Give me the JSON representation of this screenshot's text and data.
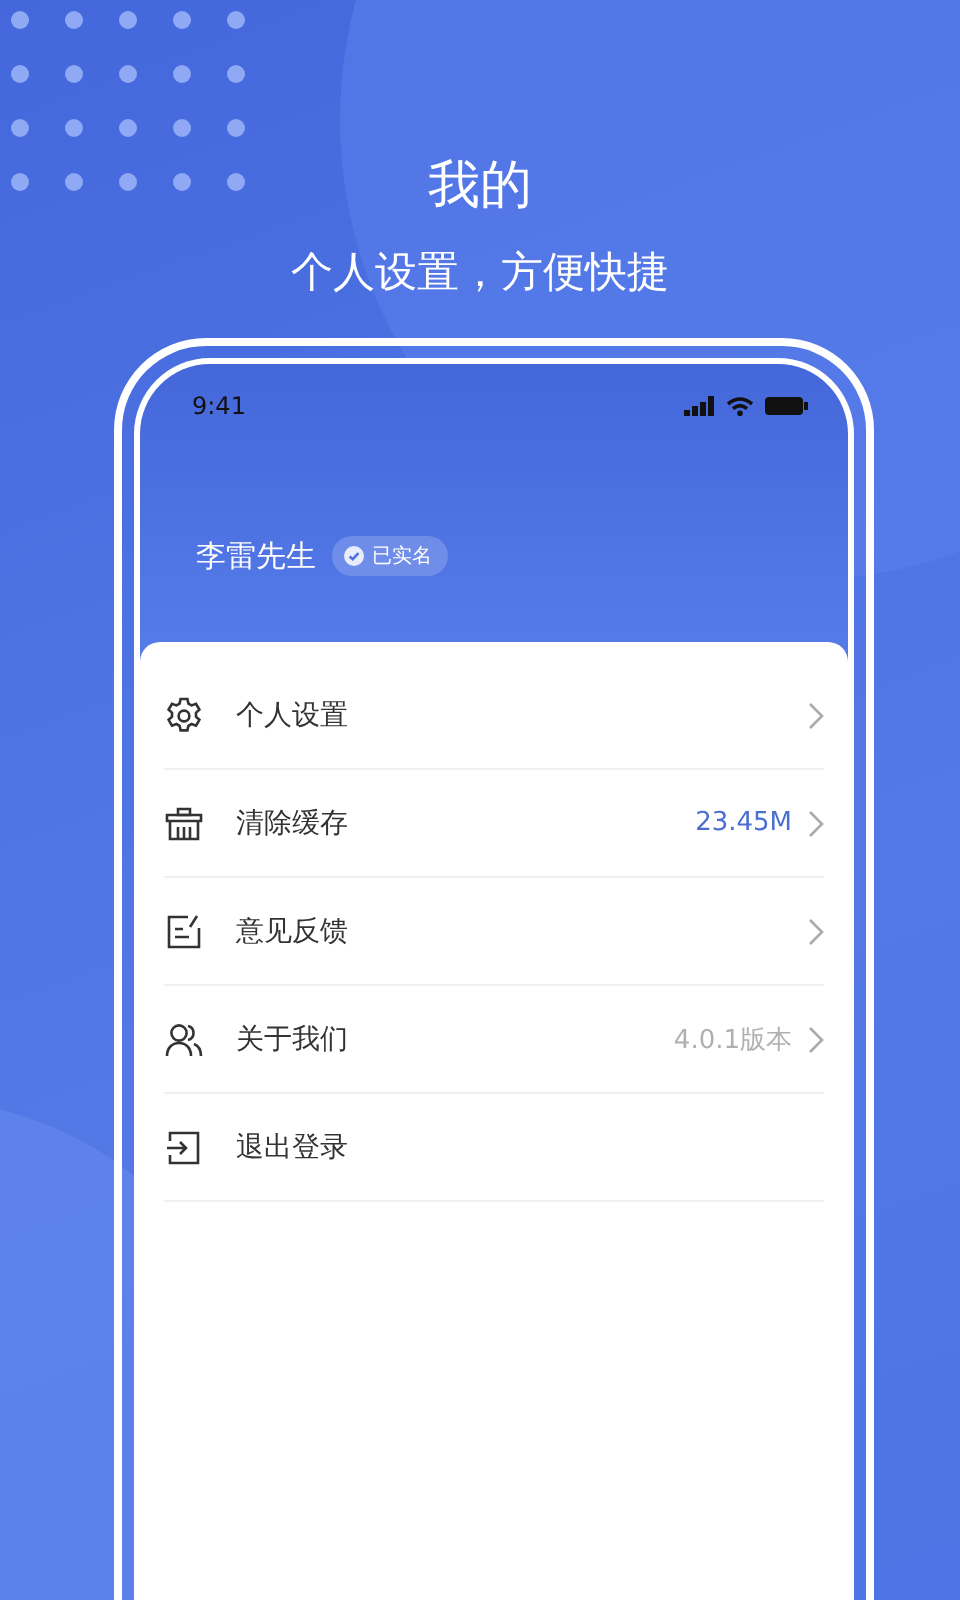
{
  "headline": {
    "title": "我的",
    "subtitle": "个人设置，方便快捷"
  },
  "phone": {
    "status_bar": {
      "time": "9:41"
    },
    "profile": {
      "name": "李雷先生",
      "badge": "已实名"
    },
    "menu": [
      {
        "label": "个人设置",
        "kind": "link"
      },
      {
        "label": "清除缓存",
        "value": "23.45M",
        "kind": "accent_value"
      },
      {
        "label": "意见反馈",
        "kind": "link"
      },
      {
        "label": "关于我们",
        "value": "4.0.1版本",
        "kind": "muted_value"
      },
      {
        "label": "退出登录",
        "kind": "action"
      }
    ]
  }
}
